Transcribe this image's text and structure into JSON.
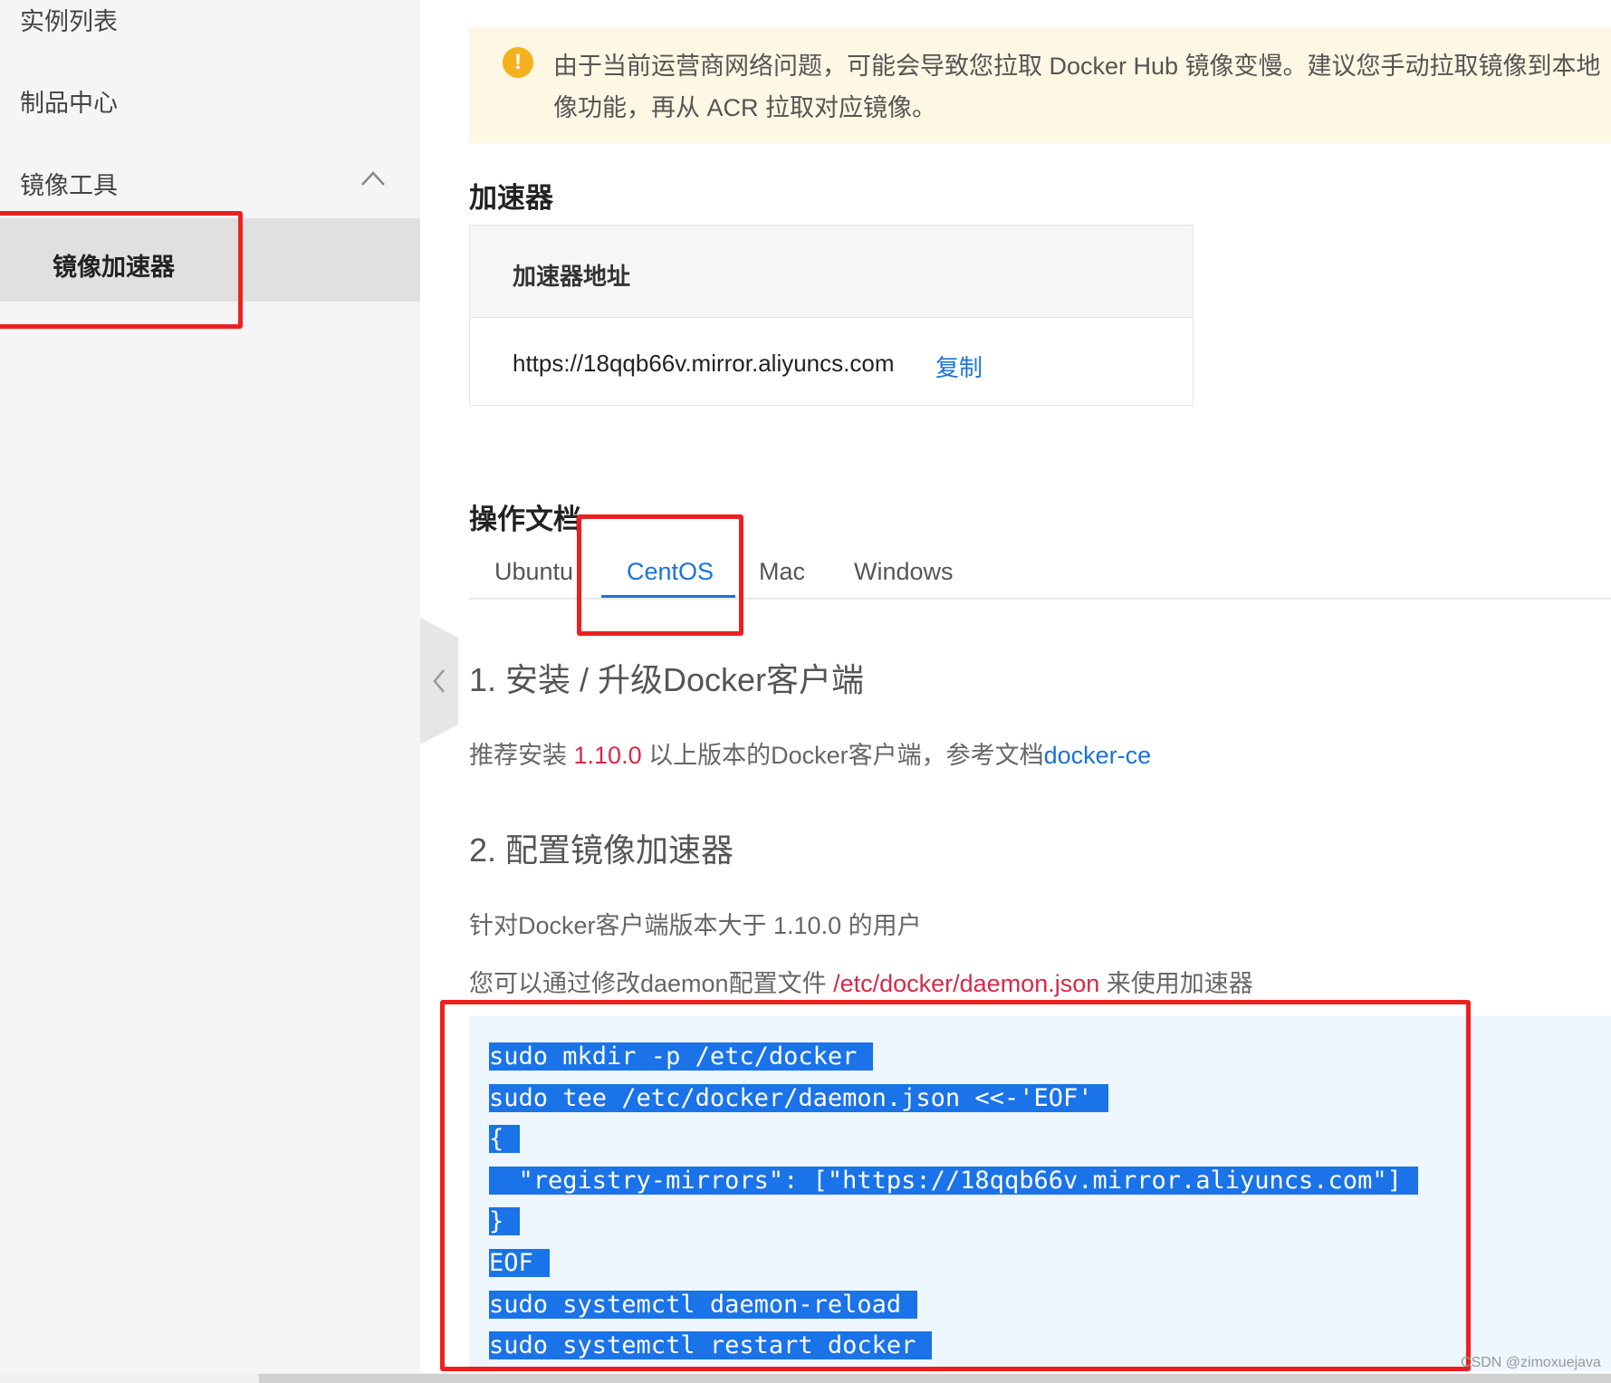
{
  "sidebar": {
    "items": [
      {
        "label": "实例列表"
      },
      {
        "label": "制品中心"
      },
      {
        "label": "镜像工具"
      }
    ],
    "sub_items": [
      {
        "label": "镜像加速器",
        "active": true
      }
    ],
    "expanded_icon": "chevron-up-icon"
  },
  "alert": {
    "icon": "warning-icon",
    "line1": "由于当前运营商网络问题，可能会导致您拉取 Docker Hub 镜像变慢。建议您手动拉取镜像到本地",
    "line2": "像功能，再从 ACR 拉取对应镜像。",
    "color": "#fdf7e3"
  },
  "accelerator": {
    "title": "加速器",
    "column_header": "加速器地址",
    "url": "https://18qqb66v.mirror.aliyuncs.com",
    "copy_label": "复制"
  },
  "docs": {
    "title": "操作文档",
    "tabs": [
      {
        "label": "Ubuntu"
      },
      {
        "label": "CentOS",
        "active": true
      },
      {
        "label": "Mac"
      },
      {
        "label": "Windows"
      }
    ],
    "section1": {
      "heading": "1. 安装 / 升级Docker客户端",
      "text_prefix": "推荐安装 ",
      "version": "1.10.0",
      "text_middle": " 以上版本的Docker客户端，参考文档",
      "link": "docker-ce"
    },
    "section2": {
      "heading": "2. 配置镜像加速器",
      "text1": "针对Docker客户端版本大于 1.10.0 的用户",
      "text2_prefix": "您可以通过修改daemon配置文件 ",
      "path": "/etc/docker/daemon.json",
      "text2_suffix": " 来使用加速器"
    },
    "code_lines": [
      "sudo mkdir -p /etc/docker",
      "sudo tee /etc/docker/daemon.json <<-'EOF'",
      "{",
      "  \"registry-mirrors\": [\"https://18qqb66v.mirror.aliyuncs.com\"]",
      "}",
      "EOF",
      "sudo systemctl daemon-reload",
      "sudo systemctl restart docker"
    ]
  },
  "watermark": "CSDN @zimoxuejava",
  "colors": {
    "accent": "#1a73d9",
    "highlight": "#1a73e8",
    "annotation": "#ec2020",
    "version_red": "#d6294a"
  }
}
